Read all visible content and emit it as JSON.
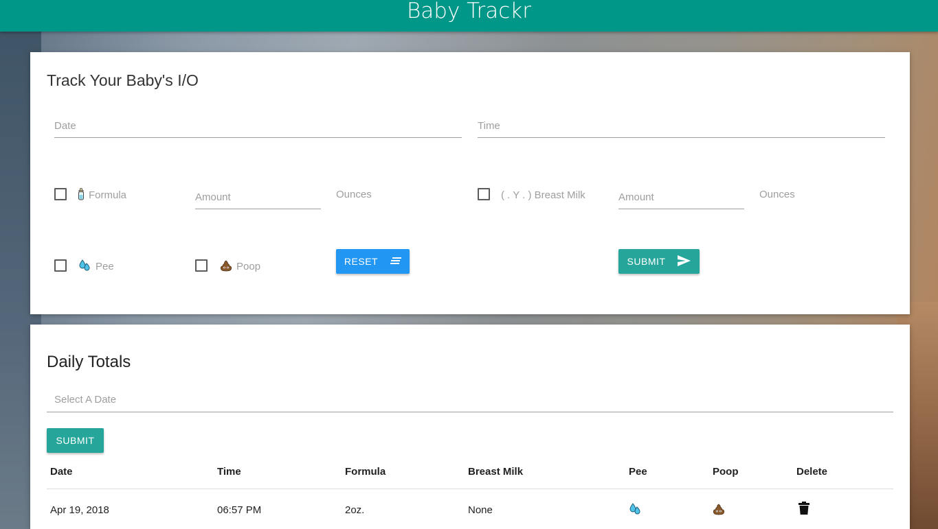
{
  "app": {
    "title": "Baby Trackr"
  },
  "tracker": {
    "heading": "Track Your Baby's I/O",
    "date_placeholder": "Date",
    "time_placeholder": "Time",
    "formula_label": "Formula",
    "formula_amount_placeholder": "Amount",
    "formula_unit": "Ounces",
    "breast_milk_label": "( . Y . ) Breast Milk",
    "breast_milk_amount_placeholder": "Amount",
    "breast_milk_unit": "Ounces",
    "pee_label": "Pee",
    "poop_label": "Poop",
    "reset_label": "RESET",
    "submit_label": "SUBMIT",
    "icons": {
      "formula": "baby-bottle-icon",
      "pee": "droplets-icon",
      "poop": "poop-icon",
      "reset": "list-lines-icon",
      "submit": "send-icon"
    }
  },
  "totals": {
    "heading": "Daily Totals",
    "date_placeholder": "Select A Date",
    "submit_label": "SUBMIT",
    "columns": [
      "Date",
      "Time",
      "Formula",
      "Breast Milk",
      "Pee",
      "Poop",
      "Delete"
    ],
    "rows": [
      {
        "date": "Apr 19, 2018",
        "time": "06:57 PM",
        "formula": "2oz.",
        "breast_milk": "None",
        "pee": "droplets-icon",
        "poop": "poop-icon",
        "delete": "trash-icon"
      }
    ]
  },
  "colors": {
    "navbar": "#009688",
    "primary": "#26a69a",
    "reset": "#2196f3"
  }
}
